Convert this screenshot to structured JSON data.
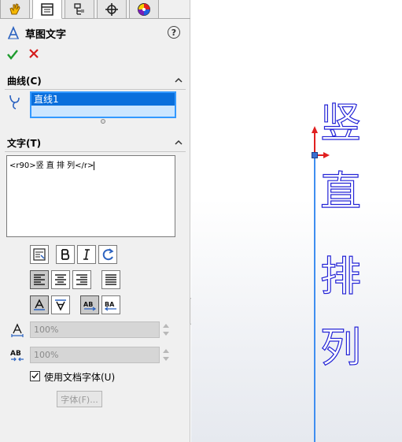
{
  "panel": {
    "title": "草图文字",
    "help": "?",
    "curves_section": {
      "label": "曲线(C)",
      "items": [
        "直线1"
      ]
    },
    "text_section": {
      "label": "文字(T)",
      "text_value": "<r90>竖 直 排 列</r>",
      "width_factor": "100%",
      "spacing": "100%",
      "use_doc_font_label": "使用文档字体(U)",
      "use_doc_font_checked": true,
      "font_button": "字体(F)..."
    }
  },
  "viewport": {
    "characters": [
      "竖",
      "直",
      "排",
      "列"
    ],
    "text_color": "#2424d6",
    "line_color": "#3f8ef0",
    "axis_color": "#e02020"
  }
}
